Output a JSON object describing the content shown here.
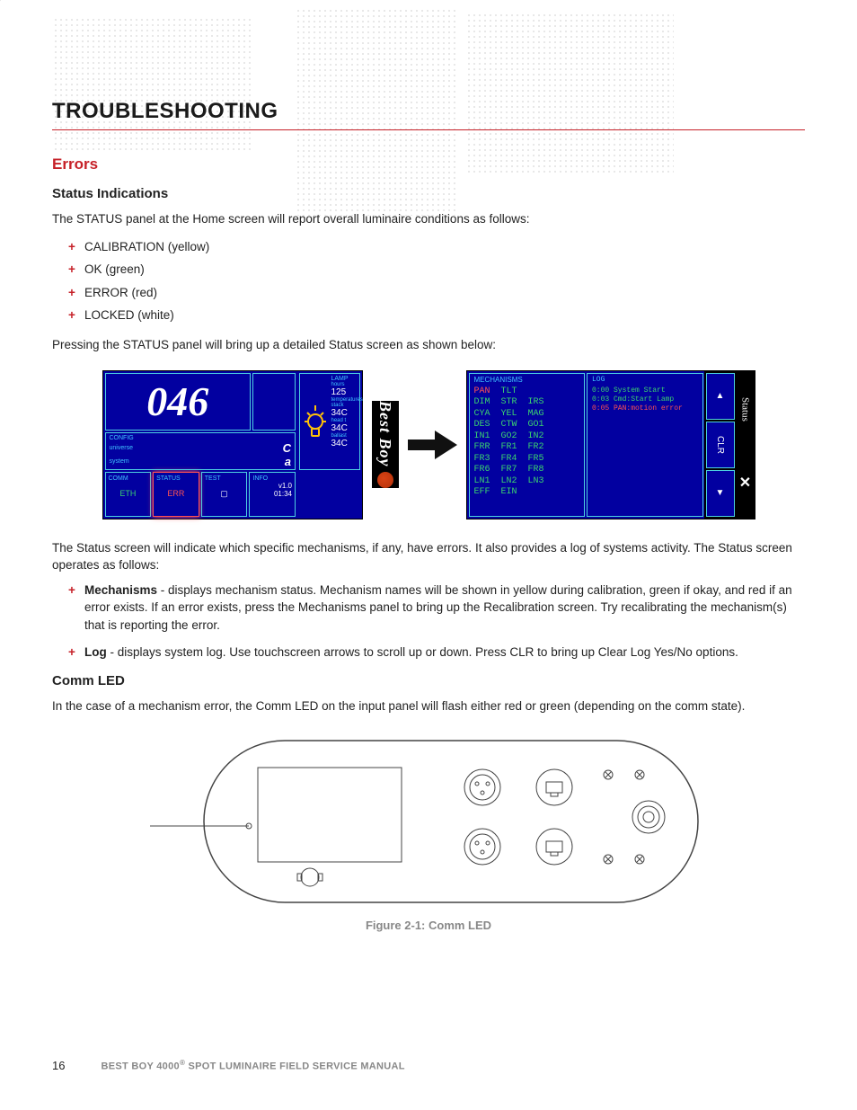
{
  "heading": "TROUBLESHOOTING",
  "section1": "Errors",
  "sub1": "Status Indications",
  "para1": "The STATUS panel at the Home screen will report overall luminaire conditions as follows:",
  "status_list": [
    "CALIBRATION (yellow)",
    "OK (green)",
    "ERROR (red)",
    "LOCKED (white)"
  ],
  "para2": "Pressing the STATUS panel will bring up a detailed Status screen as shown below:",
  "home": {
    "address": "046",
    "config_label": "CONFIG",
    "universe_label": "universe",
    "universe_val": "C",
    "system_label": "system",
    "system_val": "a",
    "comm_label": "COMM",
    "comm_val": "ETH",
    "status_label": "STATUS",
    "status_val": "ERR",
    "test_label": "TEST",
    "lamp_label": "LAMP",
    "hours": "hours",
    "hours_val": "125",
    "tempe": "temperatures stack",
    "t1": "34C",
    "head": "head t",
    "t2": "34C",
    "balla": "ballast",
    "t3": "34C",
    "info_label": "INFO",
    "version": "v1.0",
    "clock": "01:34",
    "brand": "Best Boy"
  },
  "status": {
    "mech_label": "MECHANISMS",
    "mech_rows": [
      [
        {
          "t": "PAN",
          "c": "r"
        },
        {
          "t": "TLT",
          "c": "g"
        },
        {
          "t": "",
          "c": "g"
        }
      ],
      [
        {
          "t": "DIM",
          "c": "g"
        },
        {
          "t": "STR",
          "c": "g"
        },
        {
          "t": "IRS",
          "c": "g"
        }
      ],
      [
        {
          "t": "CYA",
          "c": "g"
        },
        {
          "t": "YEL",
          "c": "g"
        },
        {
          "t": "MAG",
          "c": "g"
        }
      ],
      [
        {
          "t": "DES",
          "c": "g"
        },
        {
          "t": "CTW",
          "c": "g"
        },
        {
          "t": "GO1",
          "c": "g"
        }
      ],
      [
        {
          "t": "IN1",
          "c": "g"
        },
        {
          "t": "GO2",
          "c": "g"
        },
        {
          "t": "IN2",
          "c": "g"
        }
      ],
      [
        {
          "t": "FRR",
          "c": "g"
        },
        {
          "t": "FR1",
          "c": "g"
        },
        {
          "t": "FR2",
          "c": "g"
        }
      ],
      [
        {
          "t": "FR3",
          "c": "g"
        },
        {
          "t": "FR4",
          "c": "g"
        },
        {
          "t": "FR5",
          "c": "g"
        }
      ],
      [
        {
          "t": "FR6",
          "c": "g"
        },
        {
          "t": "FR7",
          "c": "g"
        },
        {
          "t": "FR8",
          "c": "g"
        }
      ],
      [
        {
          "t": "LN1",
          "c": "g"
        },
        {
          "t": "LN2",
          "c": "g"
        },
        {
          "t": "LN3",
          "c": "g"
        }
      ],
      [
        {
          "t": "EFF",
          "c": "g"
        },
        {
          "t": "EIN",
          "c": "g"
        },
        {
          "t": "",
          "c": "g"
        }
      ]
    ],
    "log_label": "LOG",
    "log_lines": [
      {
        "t": "0:00 System Start",
        "c": "g"
      },
      {
        "t": "0:03 Cmd:Start Lamp",
        "c": "g"
      },
      {
        "t": "0:05 PAN:motion error",
        "c": "r"
      }
    ],
    "clr": "CLR",
    "side_label": "Status",
    "up": "▲",
    "down": "▼",
    "close": "✕"
  },
  "para3": "The Status screen will indicate which specific mechanisms, if any, have errors. It also provides a log of systems activity. The Status screen operates as follows:",
  "bullets2": [
    {
      "b": "Mechanisms",
      "t": " - displays mechanism status. Mechanism names will be shown in yellow during calibration, green if okay, and red if an error exists. If an error exists, press the Mechanisms panel to bring up the Recalibration screen. Try recalibrating the mechanism(s) that is reporting the error."
    },
    {
      "b": "Log",
      "t": " - displays system log. Use touchscreen arrows to scroll up or down. Press CLR to bring up Clear Log Yes/No options."
    }
  ],
  "sub2": "Comm LED",
  "para4": "In the case of a mechanism error, the Comm LED on the input panel will flash either red or green (depending on the comm state).",
  "figure_caption": "Figure 2-1:  Comm LED",
  "footer": {
    "page": "16",
    "title_pre": "BEST BOY 4000",
    "title_post": " SPOT LUMINAIRE FIELD SERVICE MANUAL"
  }
}
